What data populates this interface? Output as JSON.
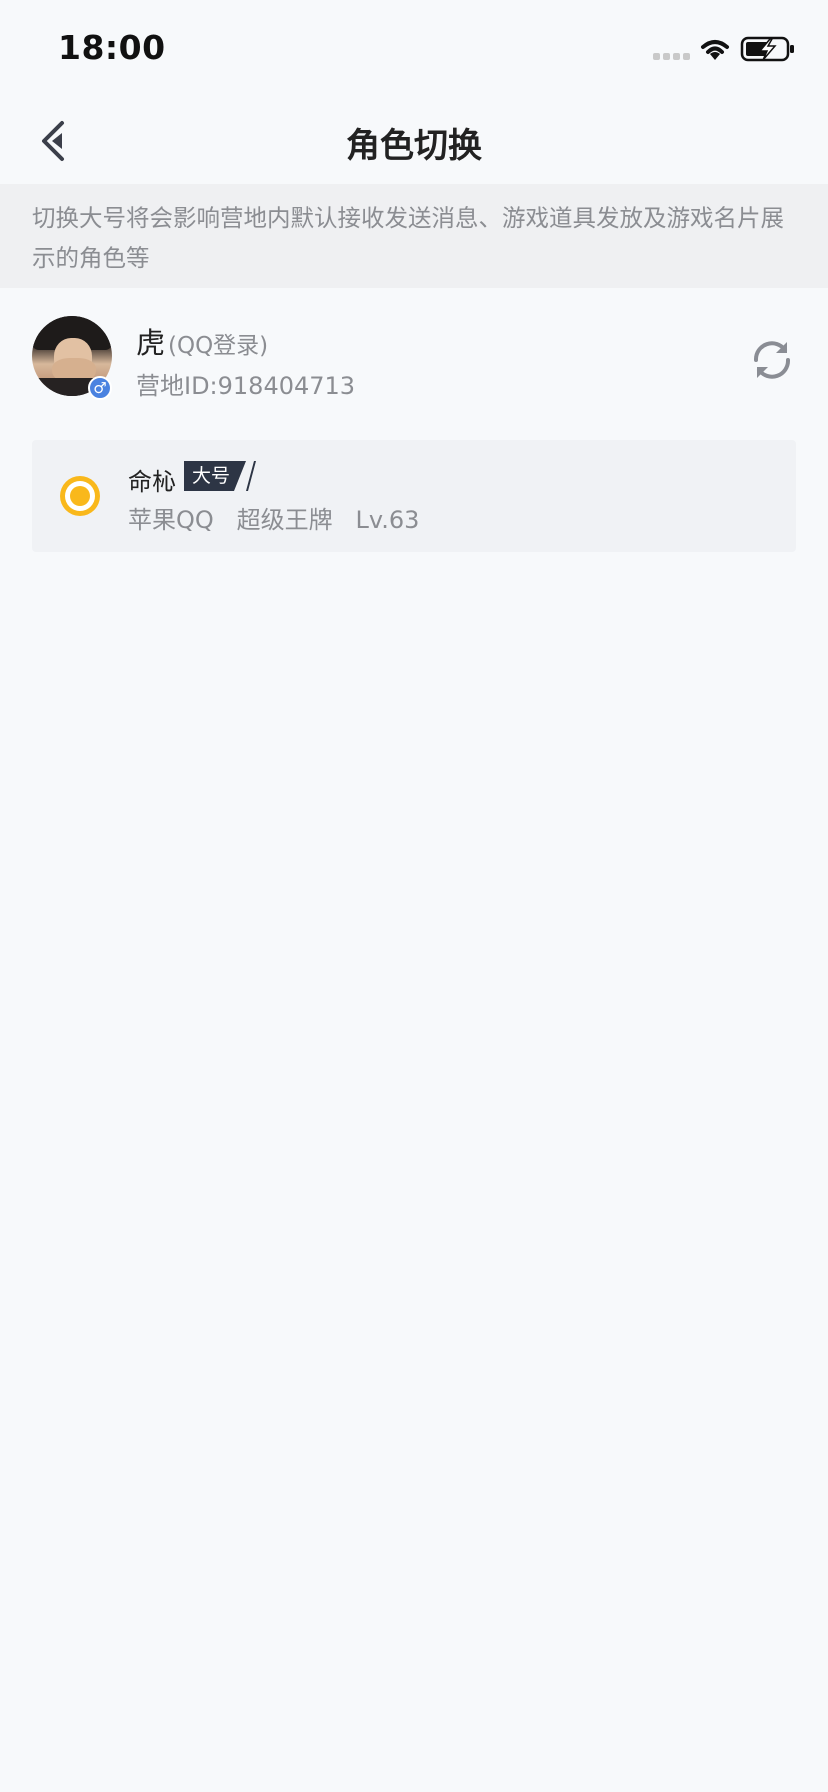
{
  "status_bar": {
    "time": "18:00",
    "icons": [
      "signal-dots-icon",
      "wifi-icon",
      "battery-charging-icon"
    ]
  },
  "nav": {
    "title": "角色切换",
    "back_icon": "chevron-left-icon"
  },
  "notice": {
    "text": "切换大号将会影响营地内默认接收发送消息、游戏道具发放及游戏名片展示的角色等"
  },
  "account": {
    "name": "虎",
    "login_type": "(QQ登录)",
    "camp_id": "营地ID:918404713",
    "gender_symbol": "♂",
    "refresh_icon": "refresh-icon"
  },
  "role": {
    "name": "命杺",
    "tag": "大号",
    "detail": "苹果QQ   超级王牌   Lv.63",
    "selected": true
  },
  "colors": {
    "accent": "#f9b81b",
    "tag_bg": "#2d3545",
    "gender_badge": "#4a82e0",
    "notice_bg": "#eff0f2",
    "page_bg": "#f7f9fb"
  }
}
